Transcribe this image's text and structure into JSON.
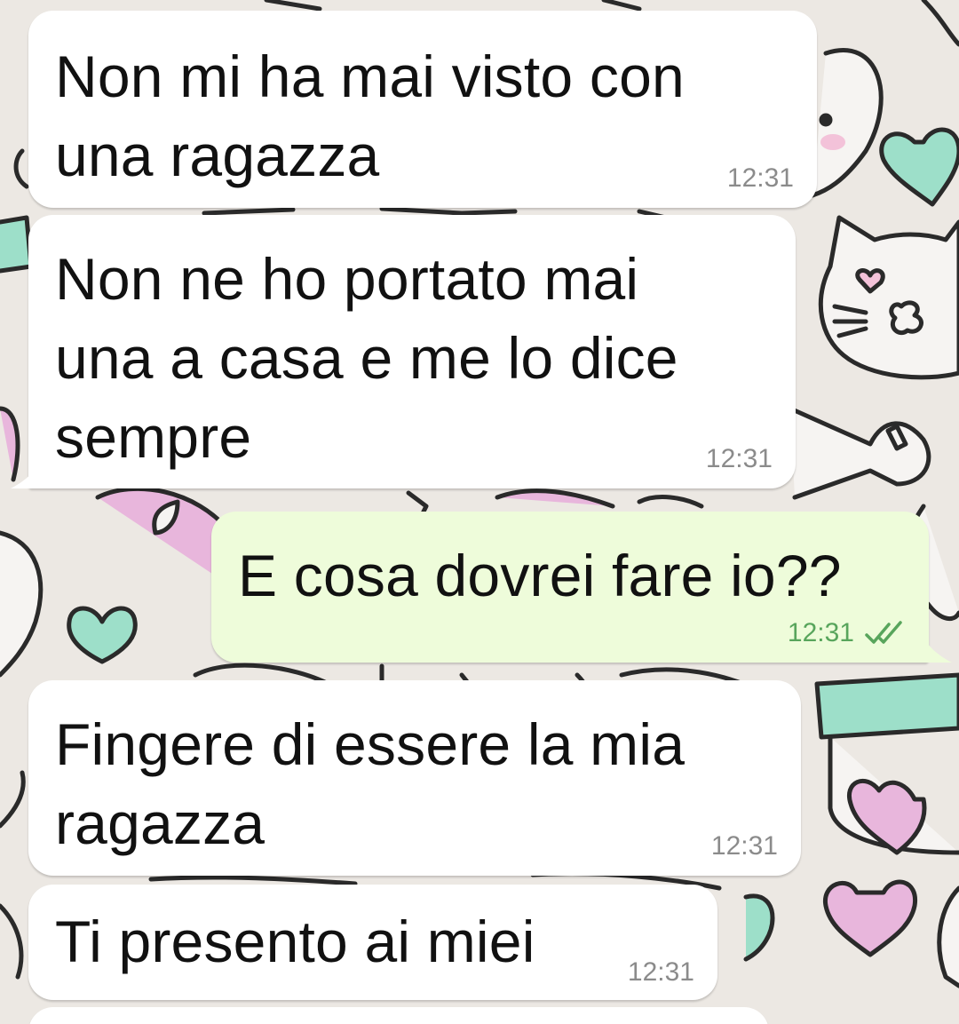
{
  "conversation": {
    "messages": [
      {
        "direction": "incoming",
        "text": "Non mi ha mai visto con\nuna ragazza",
        "time": "12:31"
      },
      {
        "direction": "incoming",
        "text": "Non ne ho portato mai\nuna a casa e me lo dice\nsempre",
        "time": "12:31"
      },
      {
        "direction": "outgoing",
        "text": "E cosa dovrei fare io??",
        "time": "12:31",
        "status_icon": "double-check-icon"
      },
      {
        "direction": "incoming",
        "text": "Fingere di essere la mia\nragazza",
        "time": "12:31"
      },
      {
        "direction": "incoming",
        "text": "Ti presento ai miei",
        "time": "12:31"
      }
    ]
  },
  "colors": {
    "incoming_bubble": "#ffffff",
    "outgoing_bubble": "#eefcda",
    "outgoing_time": "#58a55c",
    "incoming_time": "#8b8b8b",
    "wallpaper_bg": "#ece8e3",
    "wallpaper_mint": "#9ddfc9",
    "wallpaper_pink": "#e8b6dc"
  }
}
